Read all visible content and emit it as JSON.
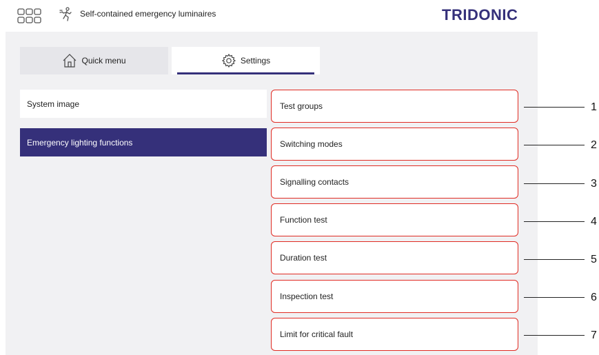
{
  "header": {
    "app_title": "Self-contained emergency luminaires",
    "brand": "TRIDONIC",
    "icons": [
      "apps-grid-icon",
      "emergency-exit-icon"
    ]
  },
  "tabs": [
    {
      "label": "Quick menu",
      "icon": "home-icon",
      "active": false
    },
    {
      "label": "Settings",
      "icon": "gear-icon",
      "active": true
    }
  ],
  "nav": [
    {
      "label": "System image",
      "selected": false
    },
    {
      "label": "Emergency lighting functions",
      "selected": true
    }
  ],
  "menu_items": [
    {
      "label": "Test groups",
      "callout": "1"
    },
    {
      "label": "Switching modes",
      "callout": "2"
    },
    {
      "label": "Signalling contacts",
      "callout": "3"
    },
    {
      "label": "Function test",
      "callout": "4"
    },
    {
      "label": "Duration test",
      "callout": "5"
    },
    {
      "label": "Inspection test",
      "callout": "6"
    },
    {
      "label": "Limit for critical fault",
      "callout": "7"
    }
  ],
  "colors": {
    "accent": "#35307a",
    "highlight_border": "#e02a22",
    "panel_bg": "#f1f1f3"
  }
}
